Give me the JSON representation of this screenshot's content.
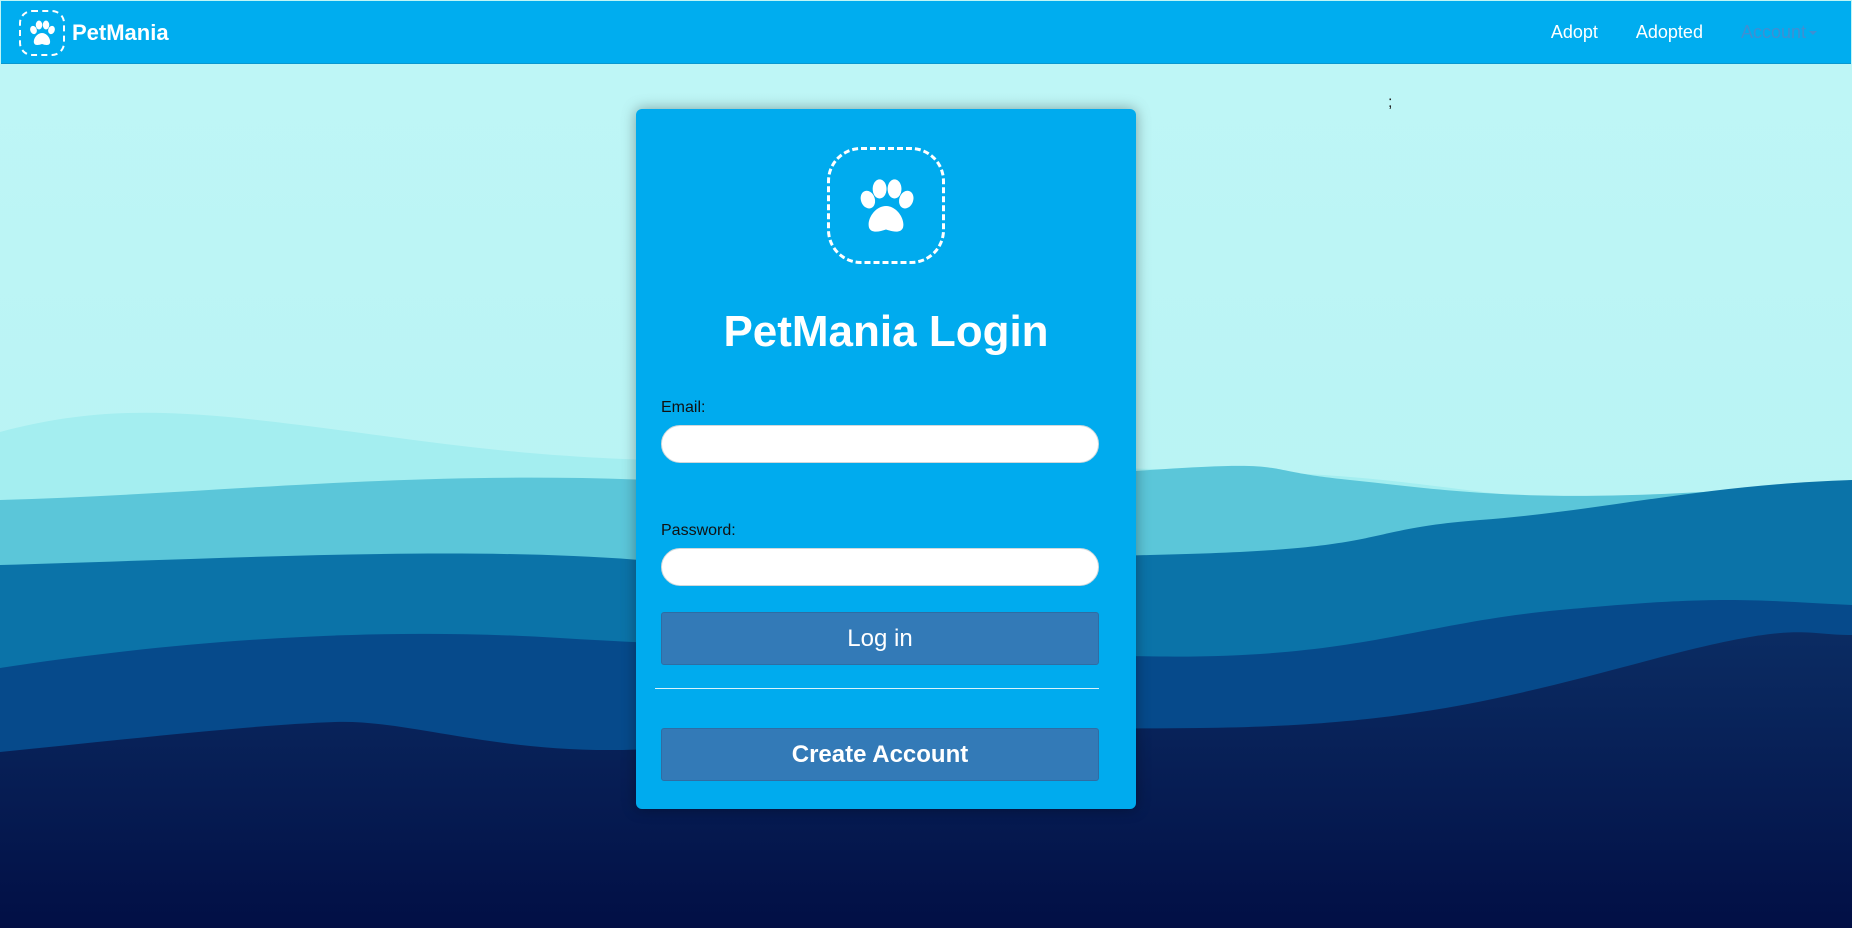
{
  "navbar": {
    "brand": "PetMania",
    "links": [
      {
        "label": "Adopt"
      },
      {
        "label": "Adopted"
      },
      {
        "label": "Account"
      }
    ]
  },
  "stray_text": ";",
  "login": {
    "title": "PetMania Login",
    "email_label": "Email:",
    "email_value": "",
    "password_label": "Password:",
    "password_value": "",
    "login_button": "Log in",
    "create_button": "Create Account"
  },
  "icons": {
    "brand": "paw-icon",
    "card": "paw-icon",
    "account": "caret-down-icon"
  },
  "colors": {
    "navbar": "#00adef",
    "card": "#00abee",
    "button": "#337ab7",
    "sky": "#bff6f6",
    "deep_sea": "#020f45"
  }
}
